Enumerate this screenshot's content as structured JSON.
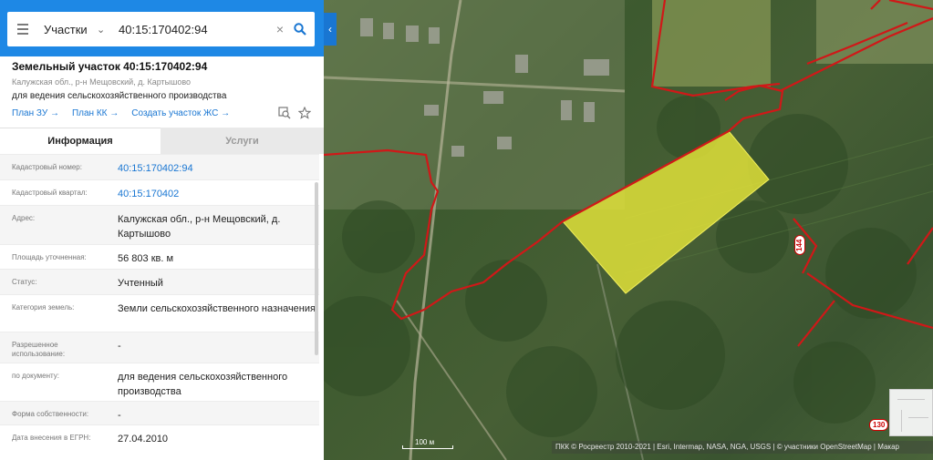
{
  "search": {
    "type_label": "Участки",
    "query": "40:15:170402:94"
  },
  "parcel": {
    "title": "Земельный участок 40:15:170402:94",
    "address_short": "Калужская обл., р-н Мещовский, д. Картышово",
    "purpose": "для ведения сельскохозяйственного производства",
    "links": [
      "План ЗУ →",
      "План КК →",
      "Создать участок ЖС →"
    ]
  },
  "tabs": [
    "Информация",
    "Услуги"
  ],
  "info_rows": [
    {
      "label": "Кадастровый номер:",
      "value": "40:15:170402:94",
      "is_link": true
    },
    {
      "label": "Кадастровый квартал:",
      "value": "40:15:170402",
      "is_link": true
    },
    {
      "label": "Адрес:",
      "value": "Калужская обл., р-н Мещовский, д. Картышово",
      "is_link": false
    },
    {
      "label": "Площадь уточненная:",
      "value": "56 803 кв. м",
      "is_link": false
    },
    {
      "label": "Статус:",
      "value": "Учтенный",
      "is_link": false
    },
    {
      "label": "Категория земель:",
      "value": "Земли сельскохозяйственного назначения",
      "is_link": false
    },
    {
      "label": "Разрешенное использование:",
      "value": "-",
      "is_link": false
    },
    {
      "label": "по документу:",
      "value": "для ведения сельскохозяйственного производства",
      "is_link": false
    },
    {
      "label": "Форма собственности:",
      "value": "-",
      "is_link": false
    },
    {
      "label": "Дата внесения в ЕГРН:",
      "value": "27.04.2010",
      "is_link": false
    }
  ],
  "map": {
    "scale_label": "100 м",
    "attribution": "ПКК © Росреестр 2010-2021 | Esri, Intermap, NASA, NGA, USGS | © участники OpenStreetMap | Макар",
    "road_labels": [
      "130",
      "144"
    ],
    "colors": {
      "parcel_fill": "#e5e539",
      "boundary": "#d01818",
      "accent": "#1e88e5"
    }
  }
}
